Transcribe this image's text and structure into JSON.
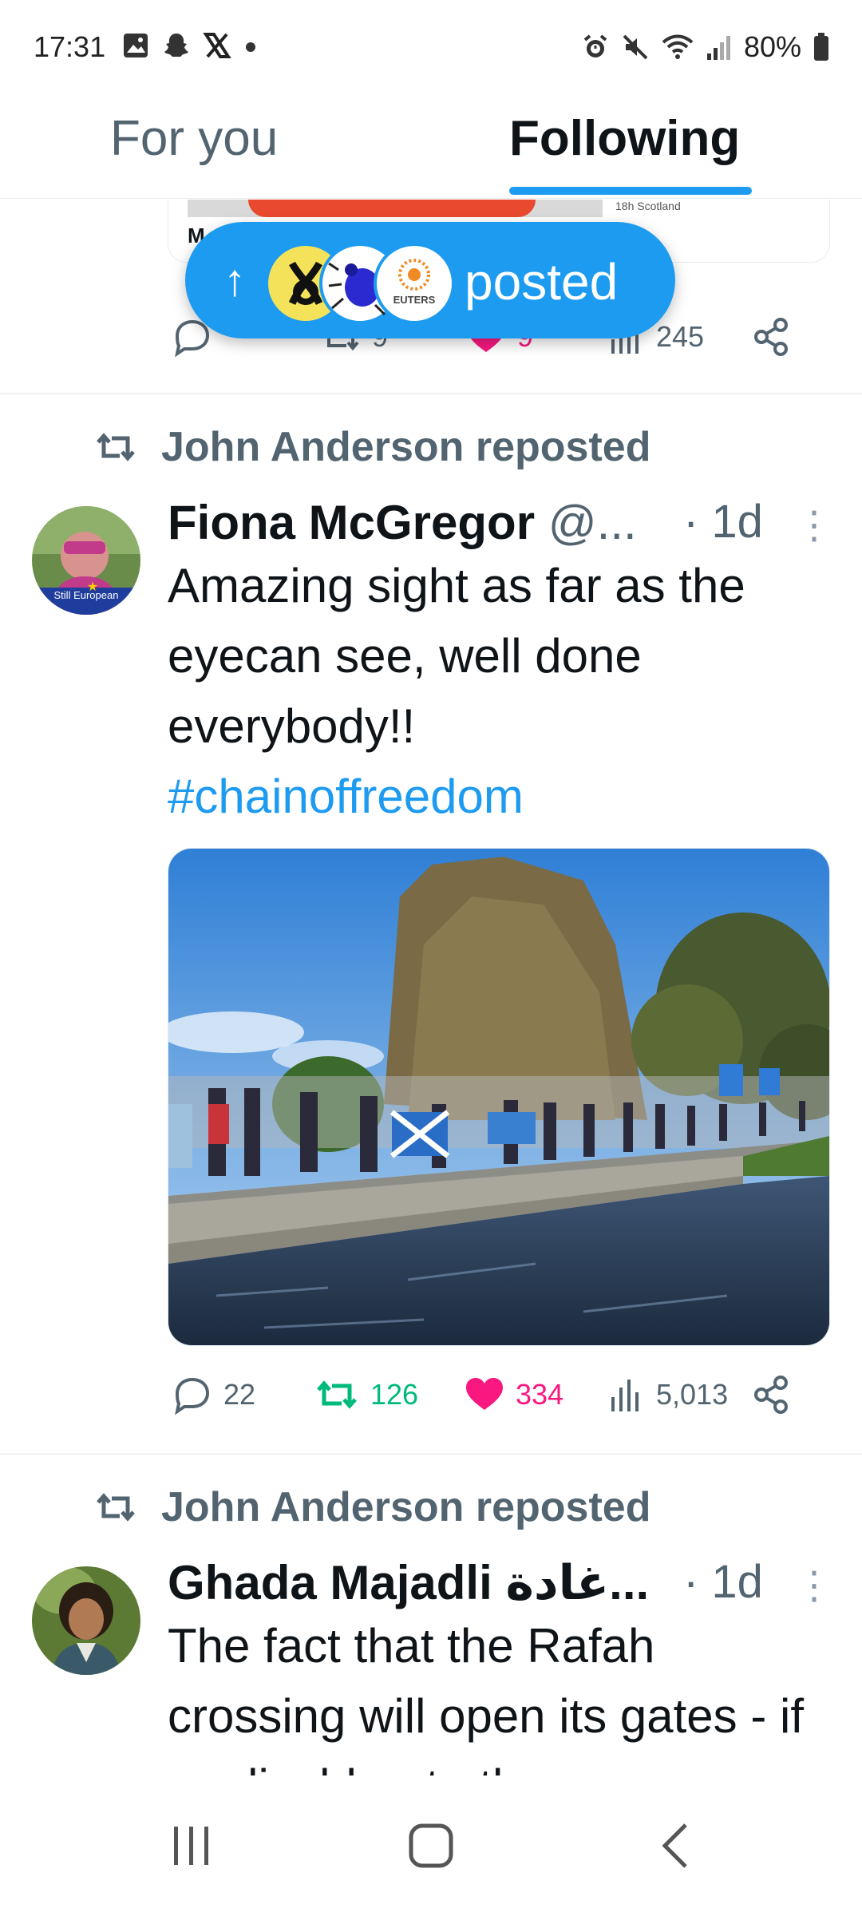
{
  "status_bar": {
    "time": "17:31",
    "battery": "80%",
    "left_icons": [
      "gallery-icon",
      "snapchat-icon",
      "x-logo-icon",
      "dot-icon"
    ],
    "right_icons": [
      "alarm-icon",
      "mute-icon",
      "wifi-icon",
      "signal-icon",
      "battery-icon"
    ]
  },
  "tabs": {
    "for_you": "For you",
    "following": "Following",
    "active": "Following"
  },
  "posted_pill": {
    "label": "posted",
    "avatar_text": "EUTERS"
  },
  "prev_tweet": {
    "card_meta": "18h Scotland",
    "card_title_fragment": "M",
    "retweets": "9",
    "likes": "9",
    "views": "245"
  },
  "tweets": [
    {
      "reposted_by": "John Anderson reposted",
      "name": "Fiona McGregor",
      "handle": "@...",
      "time": "· 1d",
      "text": "Amazing sight as far as the eyecan see, well done everybody!!",
      "hashtag": "#chainoffreedom",
      "avatar_badge": "Still European",
      "replies": "22",
      "retweets": "126",
      "likes": "334",
      "views": "5,013"
    },
    {
      "reposted_by": "John Anderson reposted",
      "name": "Ghada Majadli غادة...",
      "handle": "",
      "time": "· 1d",
      "text": "The fact that the Rafah crossing will open its gates - if applicable - to those"
    }
  ],
  "colors": {
    "accent": "#1d9bf0",
    "retweet_green": "#00ba7c",
    "like_pink": "#f91880",
    "secondary_text": "#536471"
  }
}
